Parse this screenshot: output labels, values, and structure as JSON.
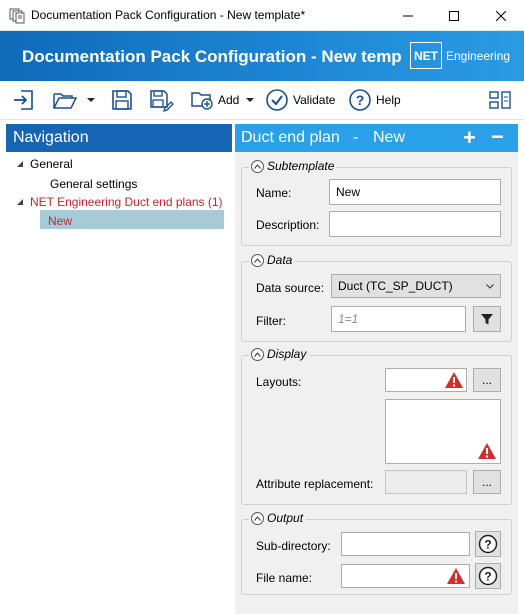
{
  "window": {
    "title": "Documentation Pack Configuration - New template*"
  },
  "banner": {
    "title": "Documentation Pack Configuration - New templ...",
    "logo_box": "NET",
    "logo_text": "Engineering"
  },
  "toolbar": {
    "add_label": "Add",
    "validate_label": "Validate",
    "help_label": "Help"
  },
  "navigation": {
    "header": "Navigation",
    "items": [
      {
        "label": "General",
        "level": 0,
        "expanded": true
      },
      {
        "label": "General settings",
        "level": 1
      },
      {
        "label": "NET Engineering Duct end plans (1)",
        "level": 0,
        "expanded": true,
        "color": "#c0272d"
      },
      {
        "label": "New",
        "level": 1,
        "selected": true,
        "color": "#c0272d"
      }
    ]
  },
  "content": {
    "header_title": "Duct end plan",
    "header_sep": "-",
    "header_state": "New",
    "add_symbol": "+",
    "remove_symbol": "−",
    "subtemplate": {
      "title": "Subtemplate",
      "name_label": "Name:",
      "name_value": "New",
      "description_label": "Description:",
      "description_value": ""
    },
    "data": {
      "title": "Data",
      "source_label": "Data source:",
      "source_value": "Duct (TC_SP_DUCT)",
      "filter_label": "Filter:",
      "filter_placeholder": "1=1"
    },
    "display": {
      "title": "Display",
      "layouts_label": "Layouts:",
      "browse_label": "...",
      "attr_label": "Attribute replacement:",
      "attr_browse_label": "..."
    },
    "output": {
      "title": "Output",
      "subdir_label": "Sub-directory:",
      "filename_label": "File name:"
    }
  },
  "colors": {
    "banner": "#1d86d4",
    "nav_header": "#1565b4",
    "content_header": "#29a0e8",
    "selection": "#a7cad9",
    "error_red": "#c0272d",
    "warning": "#d32f2f"
  }
}
